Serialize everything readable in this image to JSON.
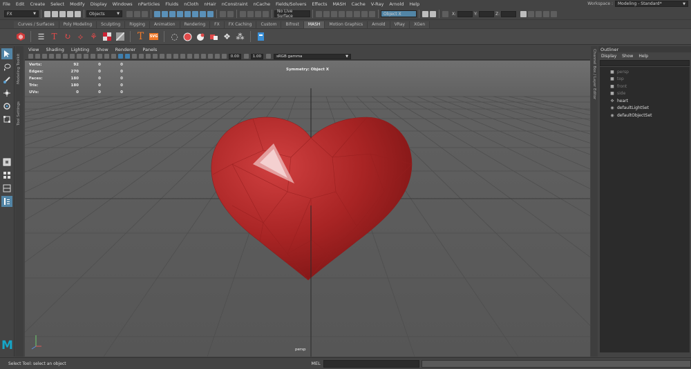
{
  "menubar": {
    "items": [
      "File",
      "Edit",
      "Create",
      "Select",
      "Modify",
      "Display",
      "Windows",
      "nParticles",
      "Fluids",
      "nCloth",
      "nHair",
      "nConstraint",
      "nCache",
      "Fields/Solvers",
      "Effects",
      "MASH",
      "Cache",
      "V-Ray",
      "Arnold",
      "Help"
    ],
    "workspace_label": "Workspace :",
    "workspace_value": "Modeling - Standard*"
  },
  "statusline": {
    "menuset": "FX",
    "selection_mode": "Objects",
    "live_surface": "No Live Surface",
    "object_field": "Object X",
    "x_label": "X:",
    "y_label": "Y:",
    "z_label": "Z:"
  },
  "shelf": {
    "tabs": [
      "Curves / Surfaces",
      "Poly Modeling",
      "Sculpting",
      "Rigging",
      "Animation",
      "Rendering",
      "FX",
      "FX Caching",
      "Custom",
      "Bifrost",
      "MASH",
      "Motion Graphics",
      "Arnold",
      "VRay",
      "XGen"
    ],
    "active_tab": "MASH",
    "svg_label": "SVG"
  },
  "panel": {
    "menu": [
      "View",
      "Shading",
      "Lighting",
      "Show",
      "Renderer",
      "Panels"
    ],
    "exposure": "0.00",
    "gamma": "1.00",
    "color_space": "sRGB gamma"
  },
  "sidetabs": {
    "left": [
      "Modeling Toolkit",
      "Tool Settings"
    ],
    "right": "Channel Box / Layer Editor"
  },
  "hud": {
    "rows": [
      {
        "label": "Verts:",
        "values": [
          "92",
          "0",
          "0"
        ]
      },
      {
        "label": "Edges:",
        "values": [
          "270",
          "0",
          "0"
        ]
      },
      {
        "label": "Faces:",
        "values": [
          "180",
          "0",
          "0"
        ]
      },
      {
        "label": "Tris:",
        "values": [
          "180",
          "0",
          "0"
        ]
      },
      {
        "label": "UVs:",
        "values": [
          "0",
          "0",
          "0"
        ]
      }
    ],
    "symmetry": "Symmetry: Object X",
    "camera": "persp"
  },
  "outliner": {
    "title": "Outliner",
    "menu": [
      "Display",
      "Show",
      "Help"
    ],
    "items": [
      {
        "label": "persp",
        "icon": "camera-icon",
        "dim": true
      },
      {
        "label": "top",
        "icon": "camera-icon",
        "dim": true
      },
      {
        "label": "front",
        "icon": "camera-icon",
        "dim": true
      },
      {
        "label": "side",
        "icon": "camera-icon",
        "dim": true
      },
      {
        "label": "heart",
        "icon": "transform-icon",
        "dim": false
      },
      {
        "label": "defaultLightSet",
        "icon": "set-icon",
        "dim": false
      },
      {
        "label": "defaultObjectSet",
        "icon": "set-icon",
        "dim": false
      }
    ]
  },
  "helpline": {
    "text": "Select Tool: select an object",
    "mel_label": "MEL"
  },
  "logo": "M",
  "colors": {
    "heart": "#b52a2a",
    "selection_accent": "#5285a6",
    "viewport_bg": "#5c5c5c"
  }
}
